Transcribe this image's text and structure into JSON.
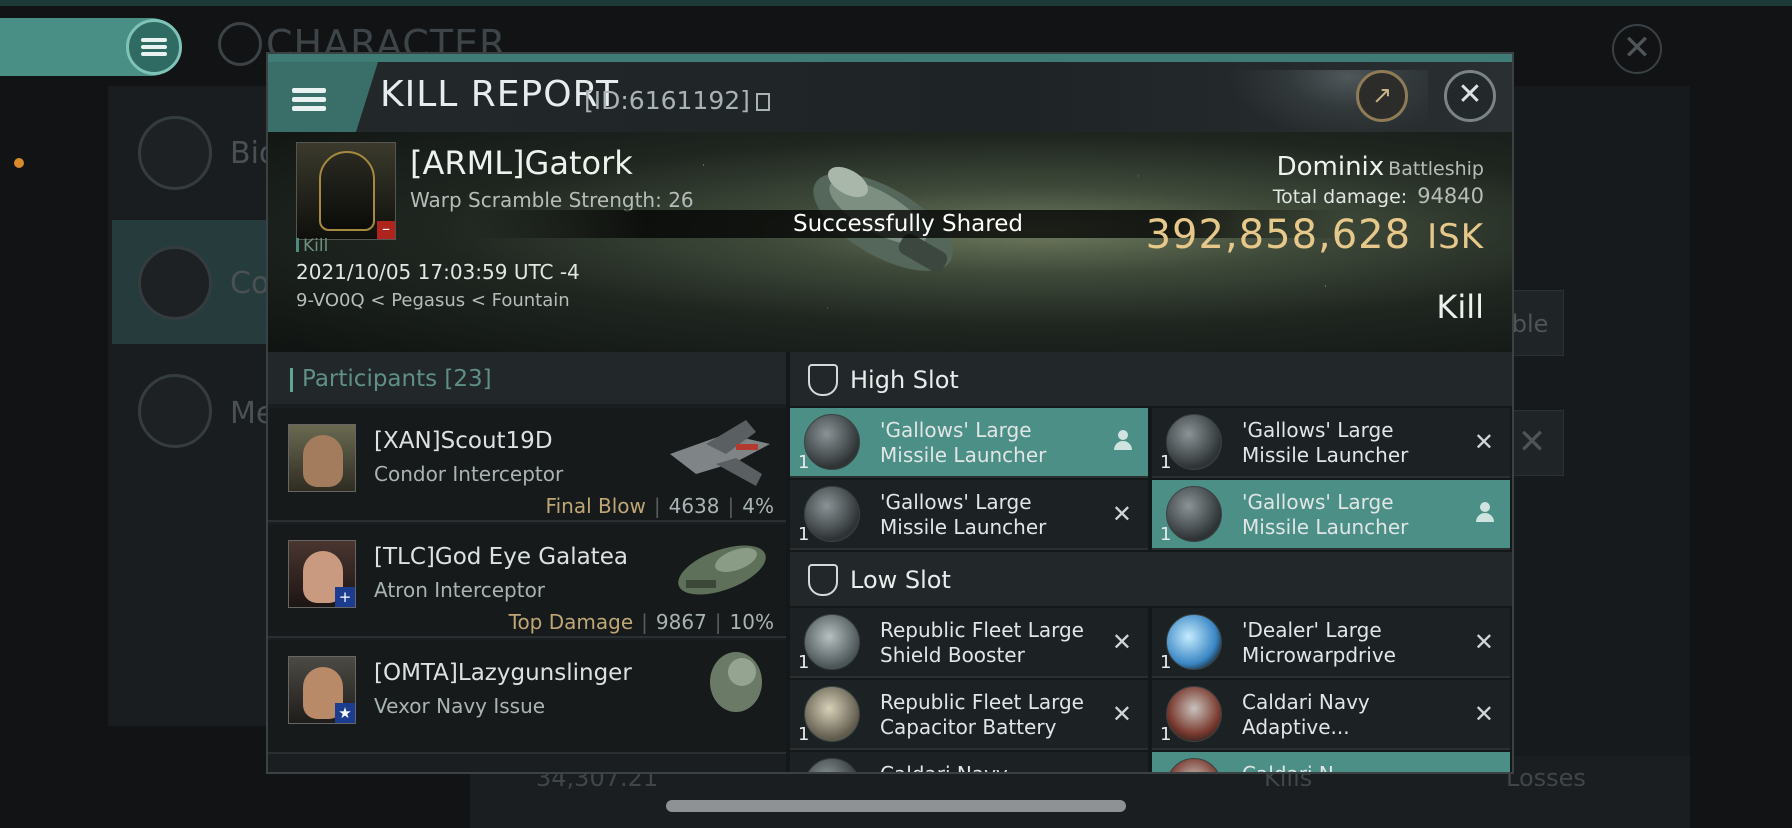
{
  "background": {
    "title": "CHARACTER",
    "side_items": [
      {
        "label": "Bio"
      },
      {
        "label": "Co"
      },
      {
        "label": "Me"
      }
    ],
    "partial_button": "able",
    "bottom": {
      "value": "34,307.21",
      "kills_label": "Kills",
      "losses_label": "Losses"
    }
  },
  "kill_report": {
    "title": "KILL REPORT",
    "id_label": "[ID:6161192]",
    "victim": {
      "name": "[ARML]Gatork",
      "warp_scramble": "Warp Scramble Strength: 26",
      "kill_tag": "Kill",
      "datetime": "2021/10/05 17:03:59 UTC -4",
      "location": "9-VO0Q < Pegasus < Fountain"
    },
    "shared_message": "Successfully Shared",
    "ship": {
      "name": "Dominix",
      "class": "Battleship",
      "total_damage_label": "Total damage:",
      "total_damage": "94840",
      "isk_value": "392,858,628",
      "isk_unit": "ISK",
      "result": "Kill"
    },
    "participants": {
      "label": "Participants",
      "count": "[23]",
      "rows": [
        {
          "name": "[XAN]Scout19D",
          "ship": "Condor Interceptor",
          "tag": "Final Blow",
          "damage": "4638",
          "percent": "4%"
        },
        {
          "name": "[TLC]God Eye Galatea",
          "ship": "Atron Interceptor",
          "tag": "Top Damage",
          "damage": "9867",
          "percent": "10%"
        },
        {
          "name": "[OMTA]Lazygunslinger",
          "ship": "Vexor Navy Issue",
          "tag": "",
          "damage": "",
          "percent": ""
        }
      ]
    },
    "high_slot": {
      "label": "High Slot",
      "modules": [
        {
          "name": "'Gallows' Large Missile Launcher",
          "qty": "1"
        },
        {
          "name": "'Gallows' Large Missile Launcher",
          "qty": "1"
        },
        {
          "name": "'Gallows' Large Missile Launcher",
          "qty": "1"
        },
        {
          "name": "'Gallows' Large Missile Launcher",
          "qty": "1"
        }
      ]
    },
    "low_slot": {
      "label": "Low Slot",
      "modules": [
        {
          "name": "Republic Fleet Large Shield Booster",
          "qty": "1"
        },
        {
          "name": "'Dealer' Large Microwarpdrive",
          "qty": "1"
        },
        {
          "name": "Republic Fleet Large Capacitor Battery",
          "qty": "1"
        },
        {
          "name": "Caldari Navy Adaptive...",
          "qty": "1"
        },
        {
          "name": "Caldari Navy...",
          "qty": ""
        },
        {
          "name": "Caldari N...",
          "qty": ""
        }
      ]
    }
  }
}
